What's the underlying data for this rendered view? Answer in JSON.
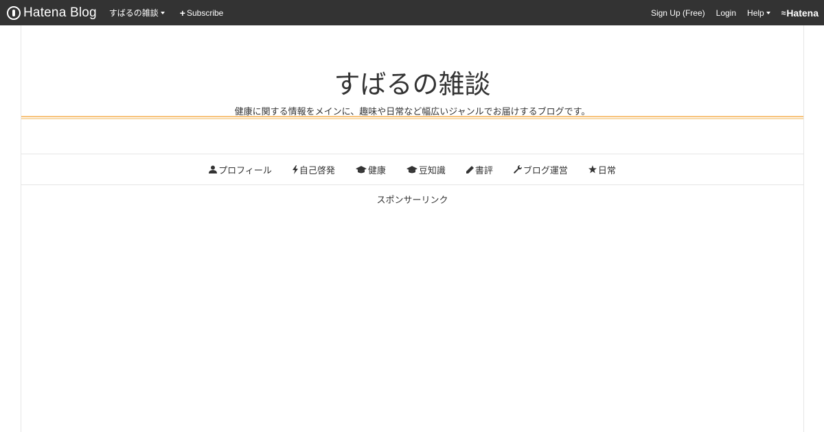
{
  "topbar": {
    "logo_text": "Hatena Blog",
    "blog_menu_label": "すばるの雑談",
    "subscribe_label": "Subscribe",
    "signup_label": "Sign Up (Free)",
    "login_label": "Login",
    "help_label": "Help",
    "brand_label": "Hatena"
  },
  "header": {
    "title": "すばるの雑談",
    "description": "健康に関する情報をメインに、趣味や日常など幅広いジャンルでお届けするブログです。"
  },
  "global_nav": {
    "items": [
      {
        "label": "プロフィール",
        "icon": "user-icon"
      },
      {
        "label": "自己啓発",
        "icon": "bolt-icon"
      },
      {
        "label": "健康",
        "icon": "graduation-cap-icon"
      },
      {
        "label": "豆知識",
        "icon": "graduation-cap-icon"
      },
      {
        "label": "書評",
        "icon": "pencil-icon"
      },
      {
        "label": " ブログ運営",
        "icon": "wrench-icon"
      },
      {
        "label": "日常",
        "icon": "star-icon"
      }
    ]
  },
  "sponsor": {
    "label": "スポンサーリンク"
  },
  "colors": {
    "topbar_bg": "#333333",
    "accent_rule": "#f8c27a"
  }
}
